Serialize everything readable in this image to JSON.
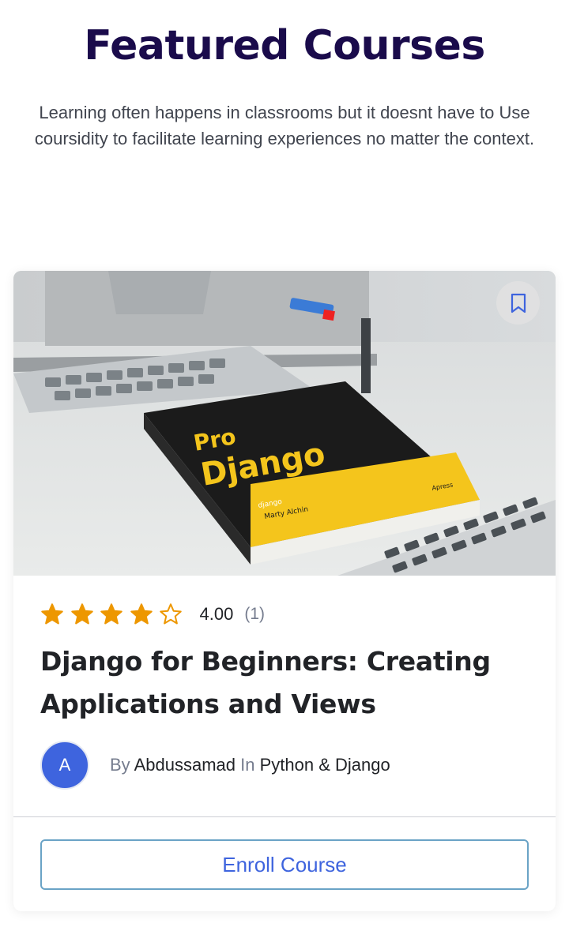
{
  "section": {
    "title": "Featured Courses",
    "subtitle": "Learning often happens in classrooms but it doesnt have to Use coursidity to facilitate learning experiences no matter the context."
  },
  "course": {
    "rating": {
      "value_text": "4.00",
      "count_text": "(1)",
      "stars_filled": 4,
      "stars_total": 5
    },
    "title": "Django for Beginners: Creating Applications and Views",
    "author": {
      "avatar_letter": "A",
      "by_label": "By",
      "name": "Abdussamad",
      "in_label": "In",
      "category": "Python & Django"
    },
    "thumbnail": {
      "book_title_line1": "Pro",
      "book_title_line2": "Django",
      "book_brand": "django",
      "book_author": "Marty Alchin",
      "book_publisher": "Apress",
      "book_spine": "Pro Django"
    },
    "enroll_label": "Enroll Course",
    "icons": {
      "bookmark": "bookmark-icon",
      "star": "star-icon"
    }
  },
  "colors": {
    "title": "#1a0b4b",
    "accent": "#3e64de",
    "star": "#ed9700",
    "button_border": "#6aa3c6"
  }
}
